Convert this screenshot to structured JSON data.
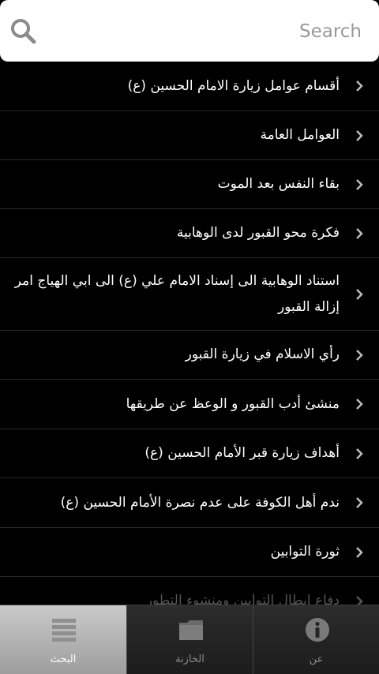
{
  "search": {
    "placeholder": "Search",
    "value": ""
  },
  "list": {
    "items": [
      {
        "label": "أقسام عوامل زيارة الامام الحسين (ع)"
      },
      {
        "label": "العوامل العامة"
      },
      {
        "label": "بقاء النفس بعد الموت"
      },
      {
        "label": "فكرة محو القبور لدى الوهابية"
      },
      {
        "label": "استناد الوهابية الى إسناد الامام علي (ع) الى ابي الهياج امر إزالة القبور"
      },
      {
        "label": "رأي الاسلام في زيارة القبور"
      },
      {
        "label": "منشئ أدب القبور و الوعظ عن طريقها"
      },
      {
        "label": "أهداف زيارة قبر الأمام الحسين (ع)"
      },
      {
        "label": "ندم أهل الكوفة على عدم نصرة الأمام الحسين (ع)"
      },
      {
        "label": "ثورة التوابين"
      },
      {
        "label": "دفاع ابطال التوابين ومنشوء التطور"
      }
    ]
  },
  "tabs": [
    {
      "label": "البحث",
      "icon": "list-icon",
      "active": true
    },
    {
      "label": "الخازنة",
      "icon": "folder-icon",
      "active": false
    },
    {
      "label": "عن",
      "icon": "info-icon",
      "active": false
    }
  ],
  "colors": {
    "background": "#000000",
    "search_bg": "#ffffff",
    "tabbar_bg": "#262626",
    "tab_active_bg": "#b5b5b5",
    "chevron": "#bbbbbb"
  }
}
